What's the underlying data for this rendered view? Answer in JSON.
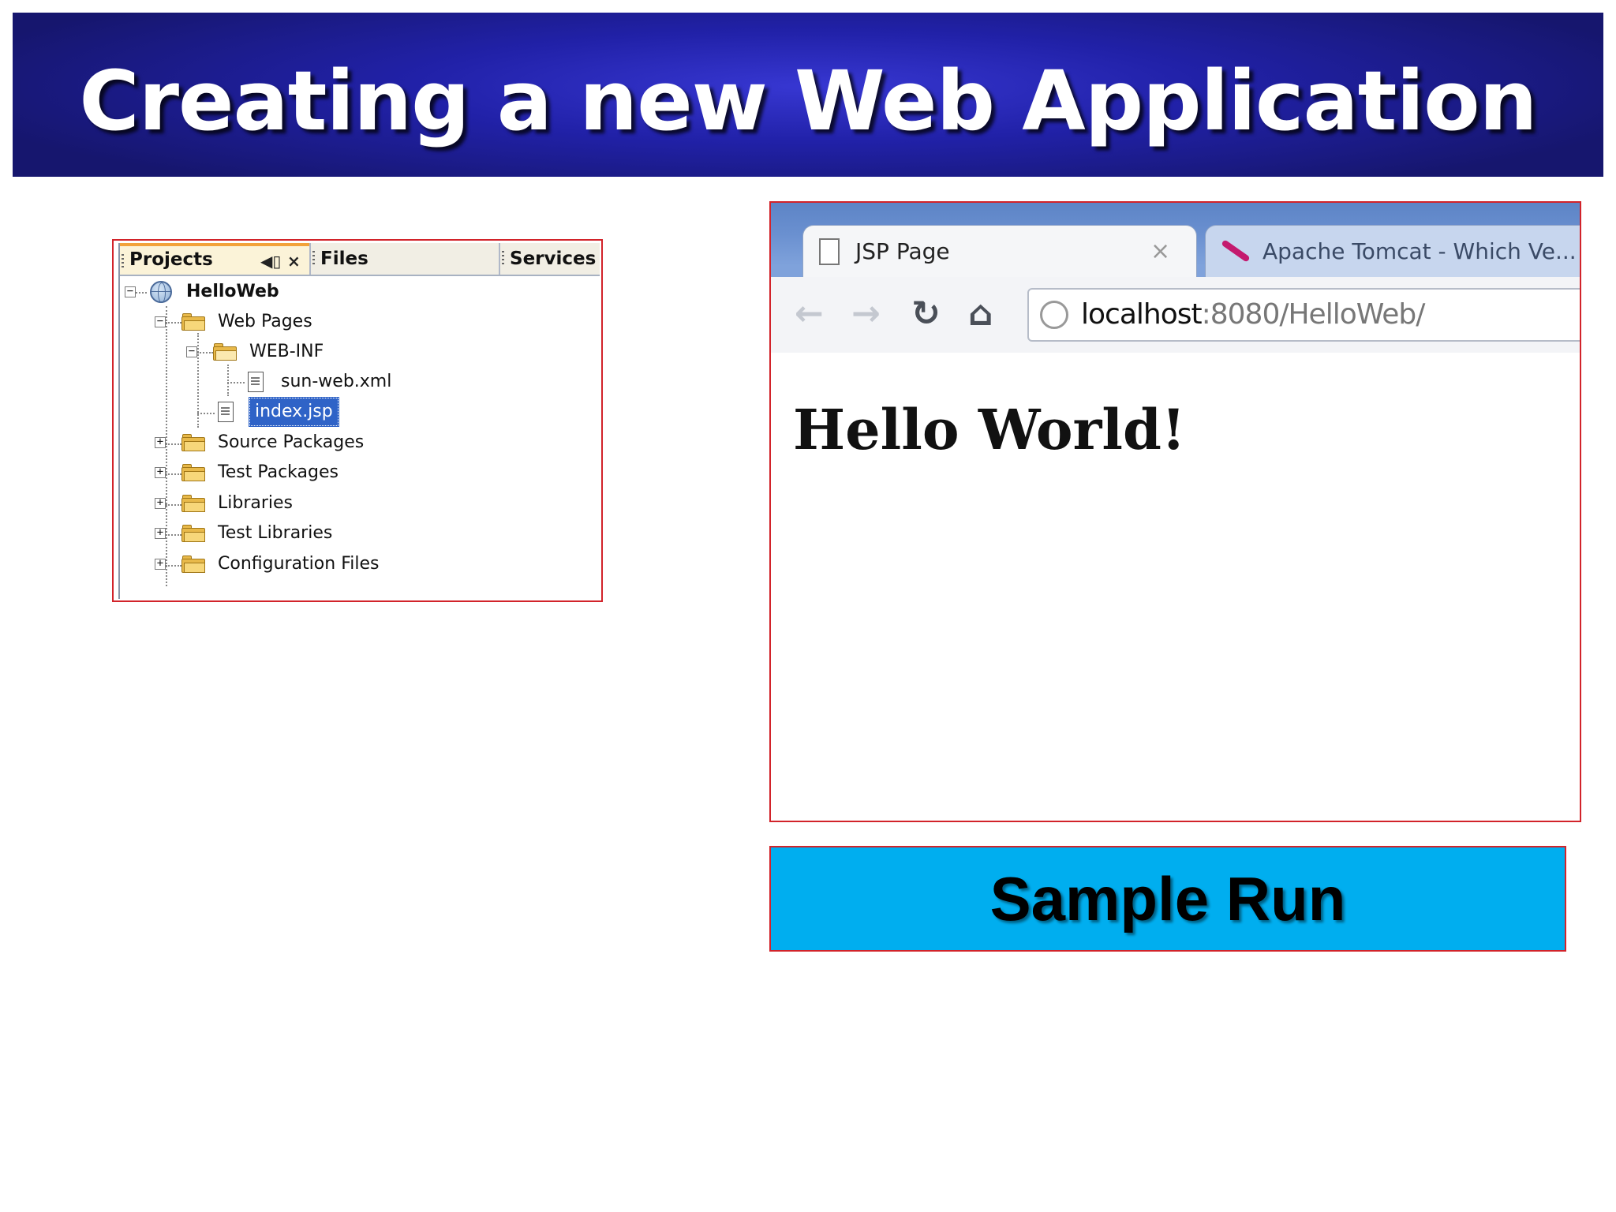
{
  "slide": {
    "title": "Creating a new Web Application",
    "caption": "Sample Run"
  },
  "projects_panel": {
    "tabs": [
      {
        "label": "Projects"
      },
      {
        "label": "Files"
      },
      {
        "label": "Services"
      }
    ],
    "tree": {
      "root": "HelloWeb",
      "web_pages": "Web Pages",
      "web_inf": "WEB-INF",
      "sun_web_xml": "sun-web.xml",
      "index_jsp": "index.jsp",
      "source_packages": "Source Packages",
      "test_packages": "Test Packages",
      "libraries": "Libraries",
      "test_libraries": "Test Libraries",
      "configuration_files": "Configuration Files"
    },
    "selected_item": "index.jsp"
  },
  "browser": {
    "active_tab": "JSP Page",
    "inactive_tab": "Apache Tomcat - Which Ve...",
    "address_host": "localhost",
    "address_rest": ":8080/HelloWeb/",
    "page_heading": "Hello World!"
  },
  "icons": {
    "back": "back-arrow-icon",
    "forward": "forward-arrow-icon",
    "reload": "reload-icon",
    "home": "home-icon",
    "globe": "globe-icon",
    "page": "page-icon",
    "tomcat": "tomcat-feather-icon"
  },
  "colors": {
    "banner": "#2121a8",
    "caption_bg": "#00aeef",
    "highlight_border": "#d2232a",
    "selection": "#2f63c7"
  }
}
